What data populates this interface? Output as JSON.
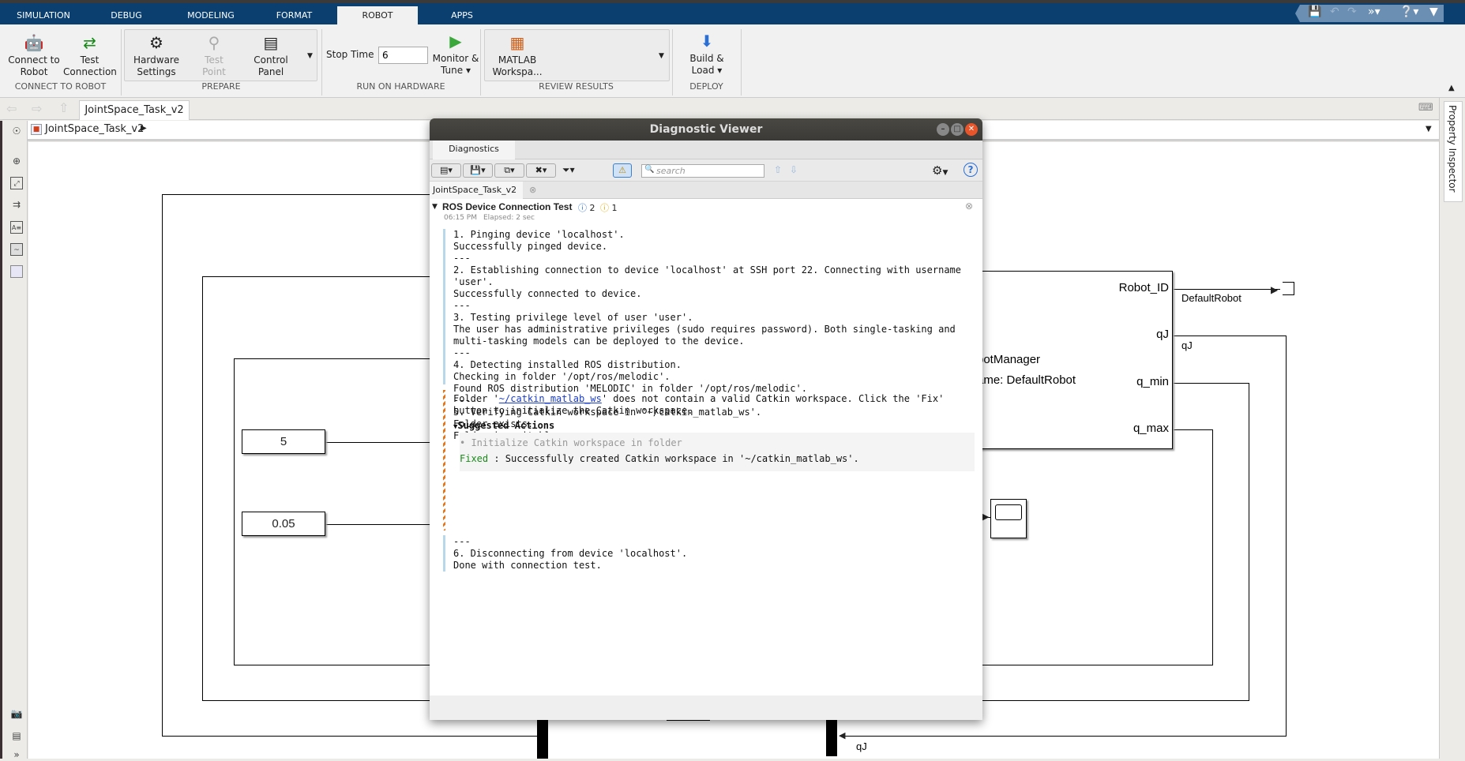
{
  "ribbon_tabs": [
    "SIMULATION",
    "DEBUG",
    "MODELING",
    "FORMAT",
    "ROBOT",
    "APPS"
  ],
  "active_tab": "ROBOT",
  "colors": {
    "tab_bar": "#0b3f6f",
    "qat": "#6a8fb3",
    "info": "#2a6fd6",
    "warning": "#e8a800",
    "fixed": "#1a8a1a",
    "link": "#1a3cc8",
    "message_bar": "#b9d7ea"
  },
  "ribbon": {
    "connect_to_robot": "Connect to Robot",
    "test_connection": "Test Connection",
    "hardware_settings": "Hardware Settings",
    "test_point": "Test Point",
    "control_panel": "Control Panel",
    "stop_time_label": "Stop Time",
    "stop_time_value": "6",
    "monitor_tune": "Monitor & Tune",
    "matlab_workspace": "MATLAB Workspa...",
    "build_load": "Build & Load",
    "groups": [
      "CONNECT TO ROBOT",
      "PREPARE",
      "RUN ON HARDWARE",
      "REVIEW RESULTS",
      "DEPLOY"
    ]
  },
  "nav": {
    "model_tab": "JointSpace_Task_v2",
    "breadcrumb": "JointSpace_Task_v2"
  },
  "property_inspector": "Property Inspector",
  "diagram": {
    "constant_1": "5",
    "constant_2": "0.05",
    "block_text_1": "botManager",
    "block_text_2": "ame: DefaultRobot",
    "ports": [
      "Robot_ID",
      "qJ",
      "q_min",
      "q_max"
    ],
    "signal_robot_id": "DefaultRobot",
    "signal_qj": "qJ",
    "signal_qj_bottom": "qJ"
  },
  "dialog": {
    "title": "Diagnostic Viewer",
    "tab": "Diagnostics",
    "search_placeholder": "search",
    "model_tab": "JointSpace_Task_v2",
    "entry_title": "ROS Device Connection Test",
    "info_count": "2",
    "warning_count": "1",
    "time": "06:15 PM",
    "elapsed": "Elapsed: 2 sec",
    "log_1": "1. Pinging device 'localhost'.\nSuccessfully pinged device.\n---\n2. Establishing connection to device 'localhost' at SSH port 22. Connecting with username\n'user'.\nSuccessfully connected to device.\n---\n3. Testing privilege level of user 'user'.\nThe user has administrative privileges (sudo requires password). Both single-tasking and\nmulti-tasking models can be deployed to the device.\n---\n4. Detecting installed ROS distribution.\nChecking in folder '/opt/ros/melodic'.\nFound ROS distribution 'MELODIC' in folder '/opt/ros/melodic'.\n---\n5. Verifying Catkin workspace in '~/catkin_matlab_ws'.\nFolder exists.\nFolder is writable.",
    "warn_prefix": "Folder '",
    "warn_link": "~/catkin_matlab_ws",
    "warn_suffix": "' does not contain a valid Catkin workspace. Click the 'Fix'\nbutton to initialize the Catkin workspace.",
    "suggested_actions": "Suggested Actions",
    "action_item": "Initialize Catkin workspace in folder",
    "fixed_label": "Fixed",
    "fixed_msg": " : Successfully created Catkin workspace in '~/catkin_matlab_ws'.",
    "log_2": "---\n6. Disconnecting from device 'localhost'.\nDone with connection test."
  }
}
